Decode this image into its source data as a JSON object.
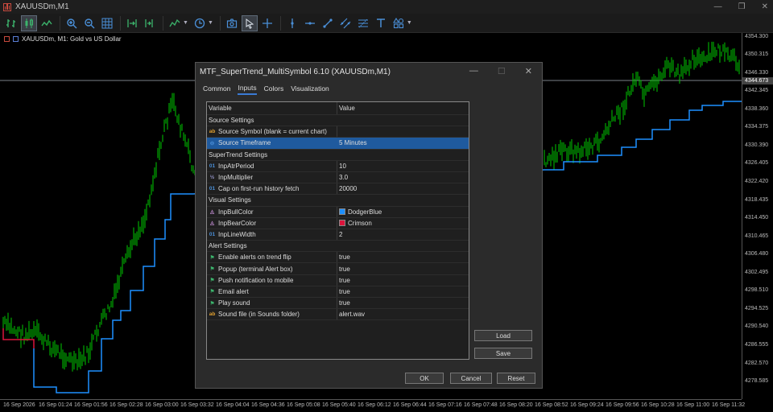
{
  "window": {
    "title": "XAUUSDm,M1",
    "controls": [
      "—",
      "❐",
      "✕"
    ]
  },
  "toolbar": {
    "icons": [
      "chart-bars-icon",
      "candlesticks-icon",
      "line-chart-icon",
      "zoom-in-icon",
      "zoom-out-icon",
      "grid-icon",
      "auto-scroll-icon",
      "chart-shift-icon",
      "indicators-icon",
      "periods-icon",
      "screenshot-icon",
      "cursor-icon",
      "crosshair-icon",
      "vertical-line-icon",
      "horizontal-line-icon",
      "trendline-icon",
      "channel-icon",
      "fibonacci-icon",
      "text-icon",
      "shapes-icon"
    ]
  },
  "chart": {
    "symbol_label": "XAUUSDm, M1:  Gold vs US Dollar",
    "price_ticks": [
      "4354.300",
      "4350.315",
      "4346.330",
      "4342.345",
      "4338.360",
      "4334.375",
      "4330.390",
      "4326.405",
      "4322.420",
      "4318.435",
      "4314.450",
      "4310.465",
      "4306.480",
      "4302.495",
      "4298.510",
      "4294.525",
      "4290.540",
      "4286.555",
      "4282.570",
      "4278.585"
    ],
    "current_price": "4344.673",
    "time_ticks": [
      "16 Sep 2026",
      "16 Sep 01:24",
      "16 Sep 01:56",
      "16 Sep 02:28",
      "16 Sep 03:00",
      "16 Sep 03:32",
      "16 Sep 04:04",
      "16 Sep 04:36",
      "16 Sep 05:08",
      "16 Sep 05:40",
      "16 Sep 06:12",
      "16 Sep 06:44",
      "16 Sep 07:16",
      "16 Sep 07:48",
      "16 Sep 08:20",
      "16 Sep 08:52",
      "16 Sep 09:24",
      "16 Sep 09:56",
      "16 Sep 10:28",
      "16 Sep 11:00",
      "16 Sep 11:32"
    ],
    "colors": {
      "candles": "#00c800",
      "bull_line": "#1e90ff",
      "bear_line": "#dc143c",
      "background": "#000000"
    }
  },
  "dialog": {
    "title": "MTF_SuperTrend_MultiSymbol 6.10 (XAUUSDm,M1)",
    "controls": [
      "—",
      "☐",
      "✕"
    ],
    "tabs": [
      {
        "label": "Common",
        "active": false
      },
      {
        "label": "Inputs",
        "active": true
      },
      {
        "label": "Colors",
        "active": false
      },
      {
        "label": "Visualization",
        "active": false
      }
    ],
    "columns": {
      "variable": "Variable",
      "value": "Value"
    },
    "rows": [
      {
        "type": "group",
        "label": "Source Settings"
      },
      {
        "type": "row",
        "icon": "ab",
        "glyph": "ab",
        "label": "Source Symbol (blank = current chart)",
        "value": ""
      },
      {
        "type": "row",
        "icon": "tf",
        "glyph": "⊖",
        "label": "Source Timeframe",
        "value": "5 Minutes",
        "selected": true
      },
      {
        "type": "group",
        "label": "SuperTrend Settings"
      },
      {
        "type": "row",
        "icon": "o1",
        "glyph": "01",
        "label": "InpAtrPeriod",
        "value": "10"
      },
      {
        "type": "row",
        "icon": "v2",
        "glyph": "½",
        "label": "InpMultiplier",
        "value": "3.0"
      },
      {
        "type": "row",
        "icon": "o1",
        "glyph": "01",
        "label": "Cap on first-run history fetch",
        "value": "20000"
      },
      {
        "type": "group",
        "label": "Visual Settings"
      },
      {
        "type": "row",
        "icon": "col",
        "glyph": "◬",
        "label": "InpBullColor",
        "value": "DodgerBlue",
        "swatch": "#1e90ff"
      },
      {
        "type": "row",
        "icon": "col",
        "glyph": "◬",
        "label": "InpBearColor",
        "value": "Crimson",
        "swatch": "#dc143c"
      },
      {
        "type": "row",
        "icon": "o1",
        "glyph": "01",
        "label": "InpLineWidth",
        "value": "2"
      },
      {
        "type": "group",
        "label": "Alert Settings"
      },
      {
        "type": "row",
        "icon": "flg",
        "glyph": "⚑",
        "label": "Enable alerts on trend flip",
        "value": "true"
      },
      {
        "type": "row",
        "icon": "flg",
        "glyph": "⚑",
        "label": "Popup (terminal Alert box)",
        "value": "true"
      },
      {
        "type": "row",
        "icon": "flg",
        "glyph": "⚑",
        "label": "Push notification to mobile",
        "value": "true"
      },
      {
        "type": "row",
        "icon": "flg",
        "glyph": "⚑",
        "label": "Email alert",
        "value": "true"
      },
      {
        "type": "row",
        "icon": "flg",
        "glyph": "⚑",
        "label": "Play sound",
        "value": "true"
      },
      {
        "type": "row",
        "icon": "ab",
        "glyph": "ab",
        "label": "Sound file (in Sounds folder)",
        "value": "alert.wav"
      }
    ],
    "buttons": {
      "load": "Load",
      "save": "Save",
      "ok": "OK",
      "cancel": "Cancel",
      "reset": "Reset"
    }
  }
}
